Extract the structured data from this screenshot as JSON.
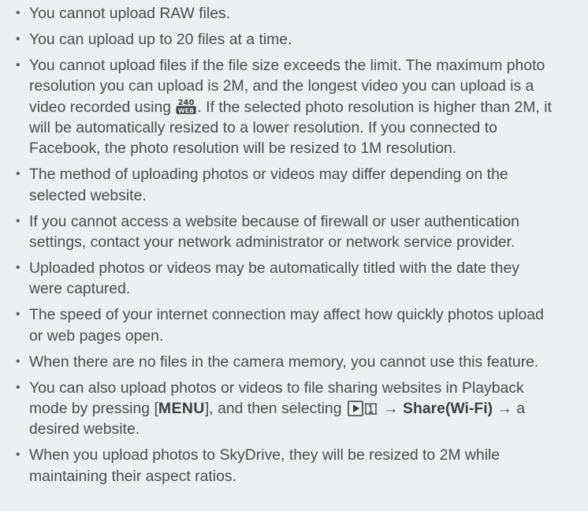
{
  "notes": {
    "bullet_glyph": "•",
    "item1": "You cannot upload RAW files.",
    "item2": "You can upload up to 20 files at a time.",
    "item3": {
      "part1": "You cannot upload files if the file size exceeds the limit. The maximum photo resolution you can upload is 2M, and the longest video you can upload is a video recorded using ",
      "icon": "resolution-240-web-icon",
      "icon_top": "240",
      "icon_bottom": "WEB",
      "part2": ". If the selected photo resolution is higher than 2M, it will be automatically resized to a lower resolution. If you connected to Facebook, the photo resolution will be resized to 1M resolution."
    },
    "item4": "The method of uploading photos or videos may differ depending on the selected website.",
    "item5": "If you cannot access a website because of firewall or user authentication settings, contact your network administrator or network service provider.",
    "item6": "Uploaded photos or videos may be automatically titled with the date they were captured.",
    "item7": "The speed of your internet connection may affect how quickly photos upload or web pages open.",
    "item8": "When there are no files in the camera memory, you cannot use this feature.",
    "item9": {
      "part1": "You can also upload photos or videos to file sharing websites in Playback mode by pressing [",
      "menu_key": "MENU",
      "part2": "], and then selecting ",
      "icon": "playback-menu-icon",
      "arrow": "→",
      "share": "Share(Wi-Fi)",
      "part3": "a desired website."
    },
    "item10": "When you upload photos to SkyDrive, they will be resized to 2M while maintaining their aspect ratios."
  }
}
